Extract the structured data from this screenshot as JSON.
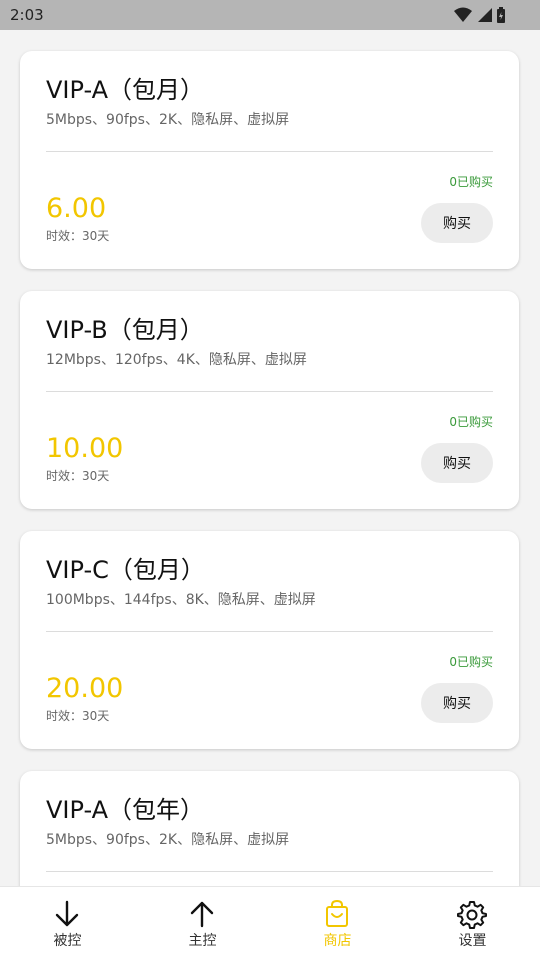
{
  "status_bar": {
    "time": "2:03"
  },
  "products": [
    {
      "title": "VIP-A（包月）",
      "spec": "5Mbps、90fps、2K、隐私屏、虚拟屏",
      "sold": "0已购买",
      "price": "6.00",
      "validity": "时效：30天",
      "buy_label": "购买"
    },
    {
      "title": "VIP-B（包月）",
      "spec": "12Mbps、120fps、4K、隐私屏、虚拟屏",
      "sold": "0已购买",
      "price": "10.00",
      "validity": "时效：30天",
      "buy_label": "购买"
    },
    {
      "title": "VIP-C（包月）",
      "spec": "100Mbps、144fps、8K、隐私屏、虚拟屏",
      "sold": "0已购买",
      "price": "20.00",
      "validity": "时效：30天",
      "buy_label": "购买"
    },
    {
      "title": "VIP-A（包年）",
      "spec": "5Mbps、90fps、2K、隐私屏、虚拟屏"
    }
  ],
  "tabs": [
    {
      "label": "被控",
      "icon": "arrow-down-icon",
      "active": false
    },
    {
      "label": "主控",
      "icon": "arrow-up-icon",
      "active": false
    },
    {
      "label": "商店",
      "icon": "shopping-bag-icon",
      "active": true
    },
    {
      "label": "设置",
      "icon": "gear-icon",
      "active": false
    }
  ],
  "colors": {
    "accent": "#f2c600",
    "sold_green": "#3a9a3a",
    "status_bar": "#b5b5b5",
    "background": "#f3f3f3"
  }
}
